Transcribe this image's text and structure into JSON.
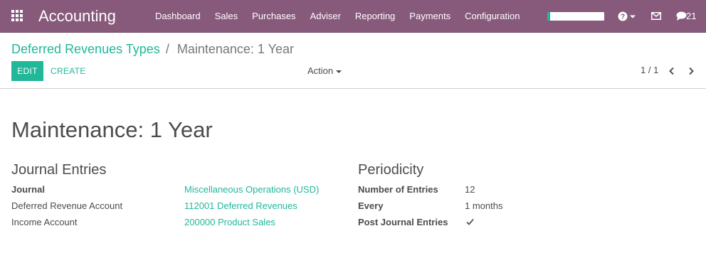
{
  "navbar": {
    "app_title": "Accounting",
    "menu": [
      {
        "label": "Dashboard"
      },
      {
        "label": "Sales"
      },
      {
        "label": "Purchases"
      },
      {
        "label": "Adviser"
      },
      {
        "label": "Reporting"
      },
      {
        "label": "Payments"
      },
      {
        "label": "Configuration"
      }
    ],
    "progress": 0.05,
    "chat_count": "21",
    "colors": {
      "bar": "#875a7b",
      "accent": "#21b799"
    },
    "icons": [
      "apps-grid-icon",
      "help-icon",
      "mail-icon",
      "chat-icon"
    ]
  },
  "breadcrumb": {
    "parent": "Deferred Revenues Types",
    "separator": "/",
    "current": "Maintenance: 1 Year"
  },
  "control": {
    "edit_label": "EDIT",
    "create_label": "CREATE",
    "action_label": "Action",
    "pager": "1 / 1"
  },
  "record": {
    "title": "Maintenance: 1 Year",
    "journal_group": {
      "title": "Journal Entries",
      "journal_label": "Journal",
      "journal_value": "Miscellaneous Operations (USD)",
      "deferred_label": "Deferred Revenue Account",
      "deferred_value": "112001 Deferred Revenues",
      "income_label": "Income Account",
      "income_value": "200000 Product Sales"
    },
    "period_group": {
      "title": "Periodicity",
      "entries_label": "Number of Entries",
      "entries_value": "12",
      "every_label": "Every",
      "every_value": "1 months",
      "post_label": "Post Journal Entries",
      "post_checked": true
    }
  }
}
